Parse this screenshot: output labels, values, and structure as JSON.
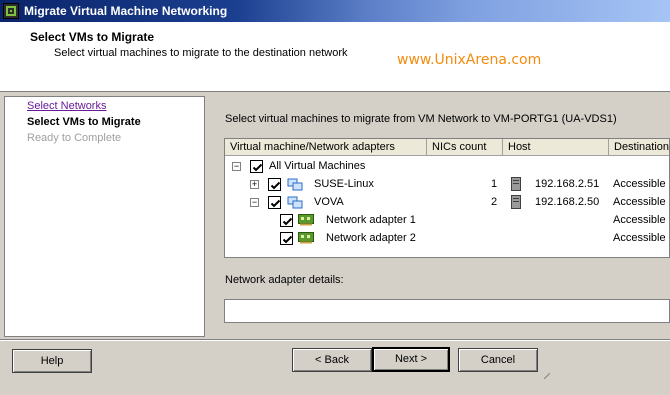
{
  "window": {
    "title": "Migrate Virtual Machine Networking"
  },
  "header": {
    "title": "Select VMs to Migrate",
    "subtitle": "Select virtual machines to migrate to the destination network",
    "brand": "www.UnixArena.com",
    "brand_color": "#f28c0f"
  },
  "steps": [
    {
      "label": "Select Networks",
      "state": "link"
    },
    {
      "label": "Select VMs to Migrate",
      "state": "current"
    },
    {
      "label": "Ready to Complete",
      "state": "disabled"
    }
  ],
  "main": {
    "instruction": "Select virtual machines to migrate from VM Network to VM-PORTG1 (UA-VDS1)",
    "table": {
      "columns": [
        "Virtual machine/Network adapters",
        "NICs count",
        "Host",
        "Destination"
      ],
      "rows": [
        {
          "name": "All Virtual Machines",
          "nics": "",
          "host": "",
          "destination": "",
          "checked": true,
          "expander": "minus",
          "icon": ""
        },
        {
          "name": "SUSE-Linux",
          "nics": "1",
          "host": "192.168.2.51",
          "destination": "Accessible",
          "checked": true,
          "expander": "plus",
          "icon": "vm-icon"
        },
        {
          "name": "VOVA",
          "nics": "2",
          "host": "192.168.2.50",
          "destination": "Accessible",
          "checked": true,
          "expander": "minus",
          "icon": "vm-icon"
        },
        {
          "name": "Network adapter 1",
          "nics": "",
          "host": "",
          "destination": "Accessible",
          "checked": true,
          "expander": "",
          "icon": "nic-icon"
        },
        {
          "name": "Network adapter 2",
          "nics": "",
          "host": "",
          "destination": "Accessible",
          "checked": true,
          "expander": "",
          "icon": "nic-icon"
        }
      ]
    },
    "details_label": "Network adapter details:"
  },
  "footer": {
    "help": "Help",
    "back": "< Back",
    "next": "Next >",
    "cancel": "Cancel"
  }
}
